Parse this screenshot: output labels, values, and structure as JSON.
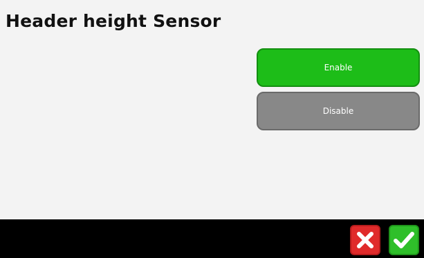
{
  "header": {
    "title": "Header height Sensor"
  },
  "options": {
    "enable_label": "Enable",
    "disable_label": "Disable",
    "selected": "Enable"
  },
  "footer": {
    "cancel_icon": "close-icon",
    "confirm_icon": "check-icon"
  },
  "colors": {
    "selected_option": "#1dbd18",
    "unselected_option": "#888888",
    "cancel": "#e02b2b",
    "confirm": "#2fbf2a",
    "background": "#f3f3f3",
    "footer_bar": "#000000"
  }
}
